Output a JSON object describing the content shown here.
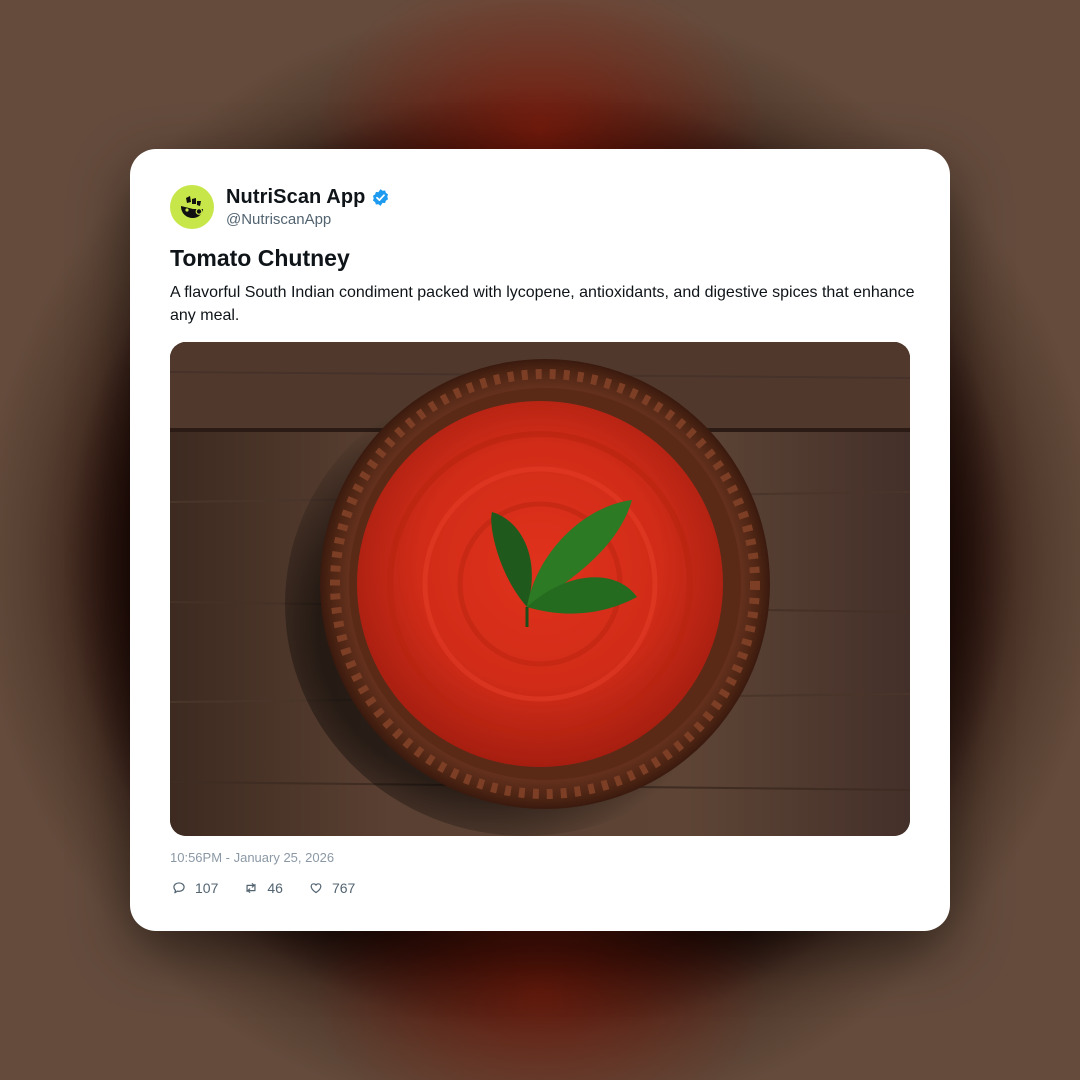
{
  "post": {
    "author": {
      "display_name": "NutriScan App",
      "handle": "@NutriscanApp",
      "verified": true,
      "avatar_icon": "nutriscan-logo-icon",
      "avatar_color": "#c6e64a"
    },
    "title": "Tomato Chutney",
    "description": "A flavorful South Indian condiment packed with lycopene, antioxidants, and digestive spices that enhance any meal.",
    "image": {
      "subject": "food-photo"
    },
    "timestamp": "10:56PM - January 25, 2026",
    "actions": {
      "replies": {
        "icon": "comment-icon",
        "count": "107"
      },
      "reposts": {
        "icon": "repost-icon",
        "count": "46"
      },
      "likes": {
        "icon": "heart-icon",
        "count": "767"
      }
    }
  },
  "colors": {
    "verified_badge": "#1d9bf0",
    "text_primary": "#0f1419",
    "text_secondary": "#536471"
  }
}
